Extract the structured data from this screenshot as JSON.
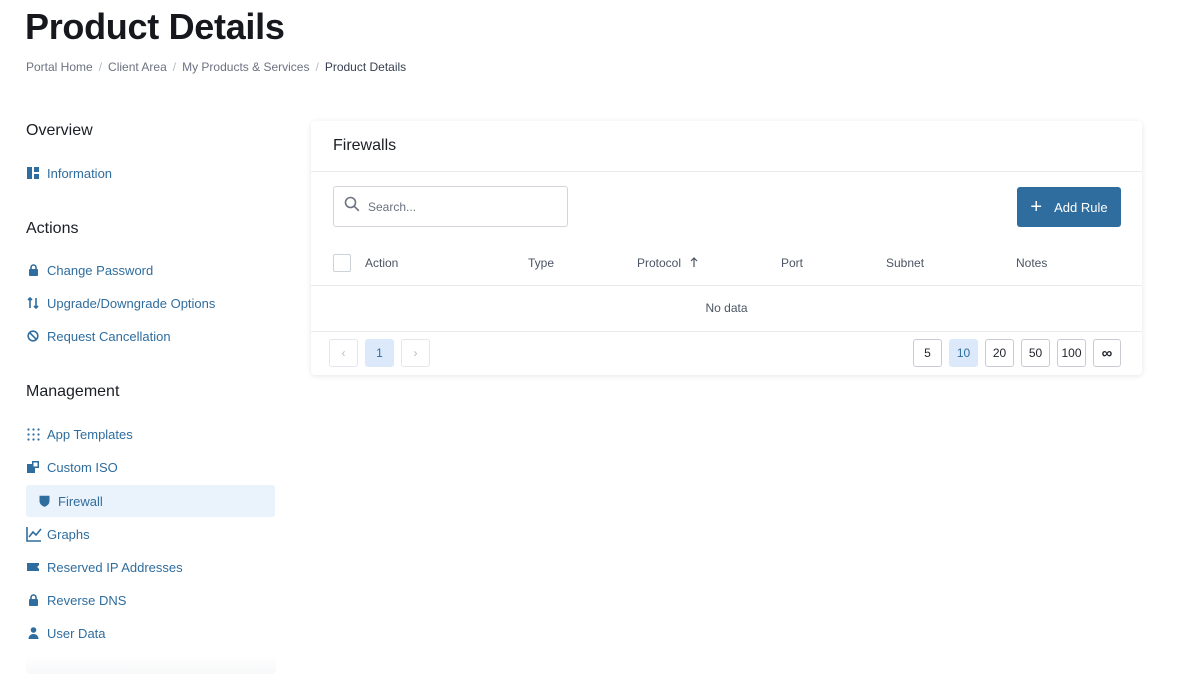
{
  "page": {
    "title": "Product Details"
  },
  "breadcrumb": [
    "Portal Home",
    "Client Area",
    "My Products & Services",
    "Product Details"
  ],
  "sidebar": {
    "overview": {
      "title": "Overview",
      "items": [
        {
          "label": "Information",
          "icon": "dashboard-icon"
        }
      ]
    },
    "actions": {
      "title": "Actions",
      "items": [
        {
          "label": "Change Password",
          "icon": "lock-icon"
        },
        {
          "label": "Upgrade/Downgrade Options",
          "icon": "sort-icon"
        },
        {
          "label": "Request Cancellation",
          "icon": "ban-icon"
        }
      ]
    },
    "management": {
      "title": "Management",
      "items": [
        {
          "label": "App Templates",
          "icon": "grid-dots-icon"
        },
        {
          "label": "Custom ISO",
          "icon": "disc-icon"
        },
        {
          "label": "Firewall",
          "icon": "shield-icon",
          "active": true
        },
        {
          "label": "Graphs",
          "icon": "chart-line-icon"
        },
        {
          "label": "Reserved IP Addresses",
          "icon": "ticket-icon"
        },
        {
          "label": "Reverse DNS",
          "icon": "lock-icon"
        },
        {
          "label": "User Data",
          "icon": "user-icon"
        }
      ]
    }
  },
  "card": {
    "title": "Firewalls",
    "search_placeholder": "Search...",
    "add_button": "Add Rule",
    "columns": [
      "Action",
      "Type",
      "Protocol",
      "Port",
      "Subnet",
      "Notes"
    ],
    "sort_column": "Protocol",
    "empty_text": "No data",
    "pagination": {
      "prev": "‹",
      "next": "›",
      "current_page": "1"
    },
    "page_sizes": [
      "5",
      "10",
      "20",
      "50",
      "100",
      "∞"
    ],
    "active_page_size": "10"
  },
  "colors": {
    "accent": "#2f6d9e",
    "active_bg": "#eaf2fc",
    "page_active_bg": "#dbe9fb"
  }
}
